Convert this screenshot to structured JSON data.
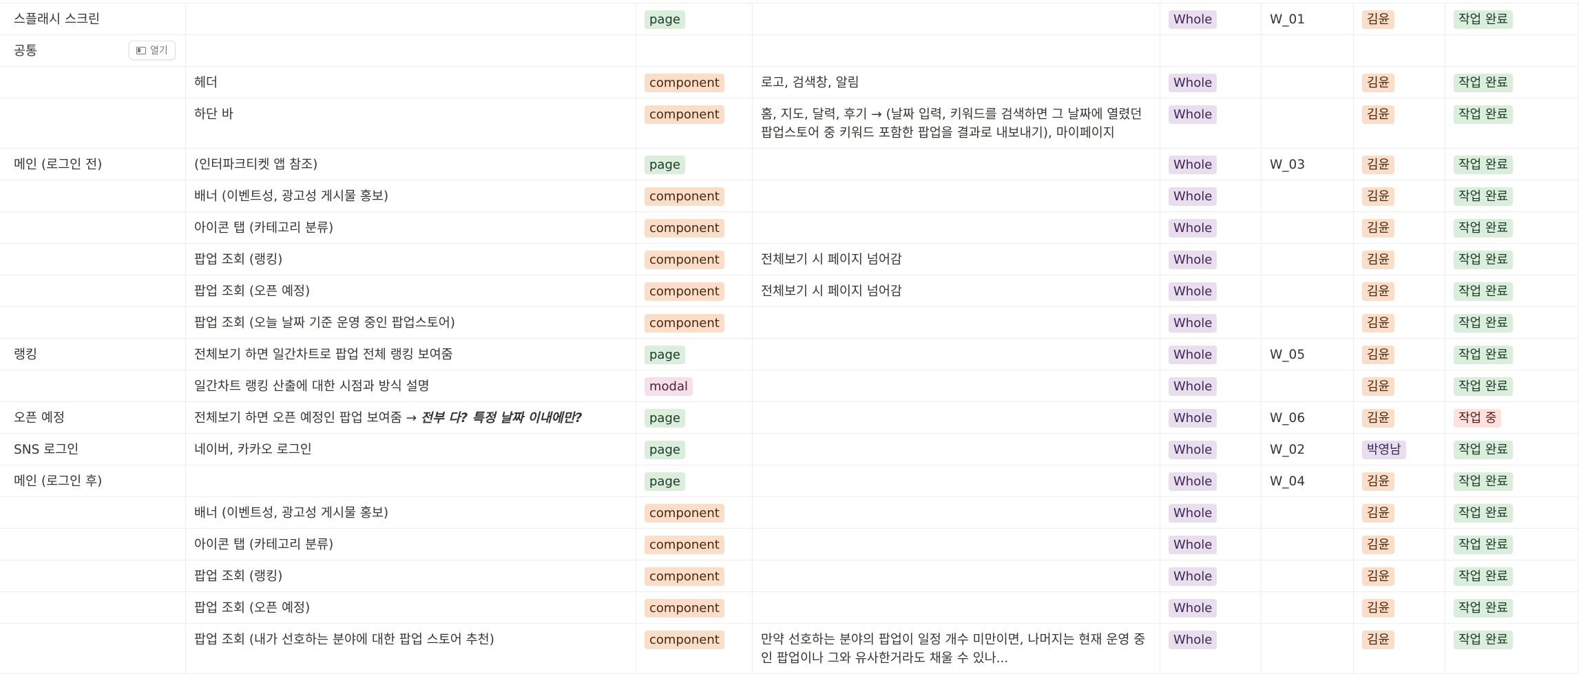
{
  "open_button_label": "열기",
  "rows": [
    {
      "name": "스플래시 스크린",
      "feature": "",
      "type": "page",
      "desc": "",
      "scope": "Whole",
      "id": "W_01",
      "owner": "김윤",
      "status": "작업 완료"
    },
    {
      "name": "공통",
      "feature": "",
      "type": "",
      "desc": "",
      "scope": "",
      "id": "",
      "owner": "",
      "status": ""
    },
    {
      "name": "",
      "feature": "헤더",
      "type": "component",
      "desc": "로고, 검색창, 알림",
      "scope": "Whole",
      "id": "",
      "owner": "김윤",
      "status": "작업 완료"
    },
    {
      "name": "",
      "feature": "하단 바",
      "type": "component",
      "desc": "홈, 지도, 달력, 후기 → (날짜 입력, 키워드를 검색하면 그 날짜에 열렸던 팝업스토어 중 키워드 포함한 팝업을 결과로 내보내기), 마이페이지",
      "scope": "Whole",
      "id": "",
      "owner": "김윤",
      "status": "작업 완료"
    },
    {
      "name": "메인 (로그인 전)",
      "feature": "(인터파크티켓 앱 참조)",
      "type": "page",
      "desc": "",
      "scope": "Whole",
      "id": "W_03",
      "owner": "김윤",
      "status": "작업 완료"
    },
    {
      "name": "",
      "feature": "배너 (이벤트성, 광고성 게시물 홍보)",
      "type": "component",
      "desc": "",
      "scope": "Whole",
      "id": "",
      "owner": "김윤",
      "status": "작업 완료"
    },
    {
      "name": "",
      "feature": "아이콘 탭 (카테고리 분류)",
      "type": "component",
      "desc": "",
      "scope": "Whole",
      "id": "",
      "owner": "김윤",
      "status": "작업 완료"
    },
    {
      "name": "",
      "feature": "팝업 조회 (랭킹)",
      "type": "component",
      "desc": "전체보기 시 페이지 넘어감",
      "scope": "Whole",
      "id": "",
      "owner": "김윤",
      "status": "작업 완료"
    },
    {
      "name": "",
      "feature": "팝업 조회 (오픈 예정)",
      "type": "component",
      "desc": "전체보기 시 페이지 넘어감",
      "scope": "Whole",
      "id": "",
      "owner": "김윤",
      "status": "작업 완료"
    },
    {
      "name": "",
      "feature": "팝업 조회 (오늘 날짜 기준 운영 중인 팝업스토어)",
      "type": "component",
      "desc": "",
      "scope": "Whole",
      "id": "",
      "owner": "김윤",
      "status": "작업 완료"
    },
    {
      "name": "랭킹",
      "feature": "전체보기 하면 일간차트로 팝업 전체 랭킹 보여줌",
      "type": "page",
      "desc": "",
      "scope": "Whole",
      "id": "W_05",
      "owner": "김윤",
      "status": "작업 완료"
    },
    {
      "name": "",
      "feature": "일간차트 랭킹 산출에 대한 시점과 방식 설명",
      "type": "modal",
      "desc": "",
      "scope": "Whole",
      "id": "",
      "owner": "김윤",
      "status": "작업 완료"
    },
    {
      "name": "오픈 예정",
      "feature": "전체보기 하면 오픈 예정인 팝업 보여줌 → ",
      "feature_em": "전부 다? 특정 날짜 이내에만?",
      "type": "page",
      "desc": "",
      "scope": "Whole",
      "id": "W_06",
      "owner": "김윤",
      "status": "작업 중"
    },
    {
      "name": "SNS 로그인",
      "feature": "네이버, 카카오 로그인",
      "type": "page",
      "desc": "",
      "scope": "Whole",
      "id": "W_02",
      "owner": "박영남",
      "status": "작업 완료"
    },
    {
      "name": "메인 (로그인 후)",
      "feature": "",
      "type": "page",
      "desc": "",
      "scope": "Whole",
      "id": "W_04",
      "owner": "김윤",
      "status": "작업 완료"
    },
    {
      "name": "",
      "feature": "배너 (이벤트성, 광고성 게시물 홍보)",
      "type": "component",
      "desc": "",
      "scope": "Whole",
      "id": "",
      "owner": "김윤",
      "status": "작업 완료"
    },
    {
      "name": "",
      "feature": "아이콘 탭 (카테고리 분류)",
      "type": "component",
      "desc": "",
      "scope": "Whole",
      "id": "",
      "owner": "김윤",
      "status": "작업 완료"
    },
    {
      "name": "",
      "feature": "팝업 조회 (랭킹)",
      "type": "component",
      "desc": "",
      "scope": "Whole",
      "id": "",
      "owner": "김윤",
      "status": "작업 완료"
    },
    {
      "name": "",
      "feature": "팝업 조회 (오픈 예정)",
      "type": "component",
      "desc": "",
      "scope": "Whole",
      "id": "",
      "owner": "김윤",
      "status": "작업 완료"
    },
    {
      "name": "",
      "feature": "팝업 조회 (내가 선호하는 분야에 대한 팝업 스토어 추천)",
      "type": "component",
      "desc": "만약 선호하는 분야의 팝업이 일정 개수 미만이면, 나머지는 현재 운영 중인 팝업이나 그와 유사한거라도 채울 수 있나...",
      "scope": "Whole",
      "id": "",
      "owner": "김윤",
      "status": "작업 완료"
    }
  ]
}
